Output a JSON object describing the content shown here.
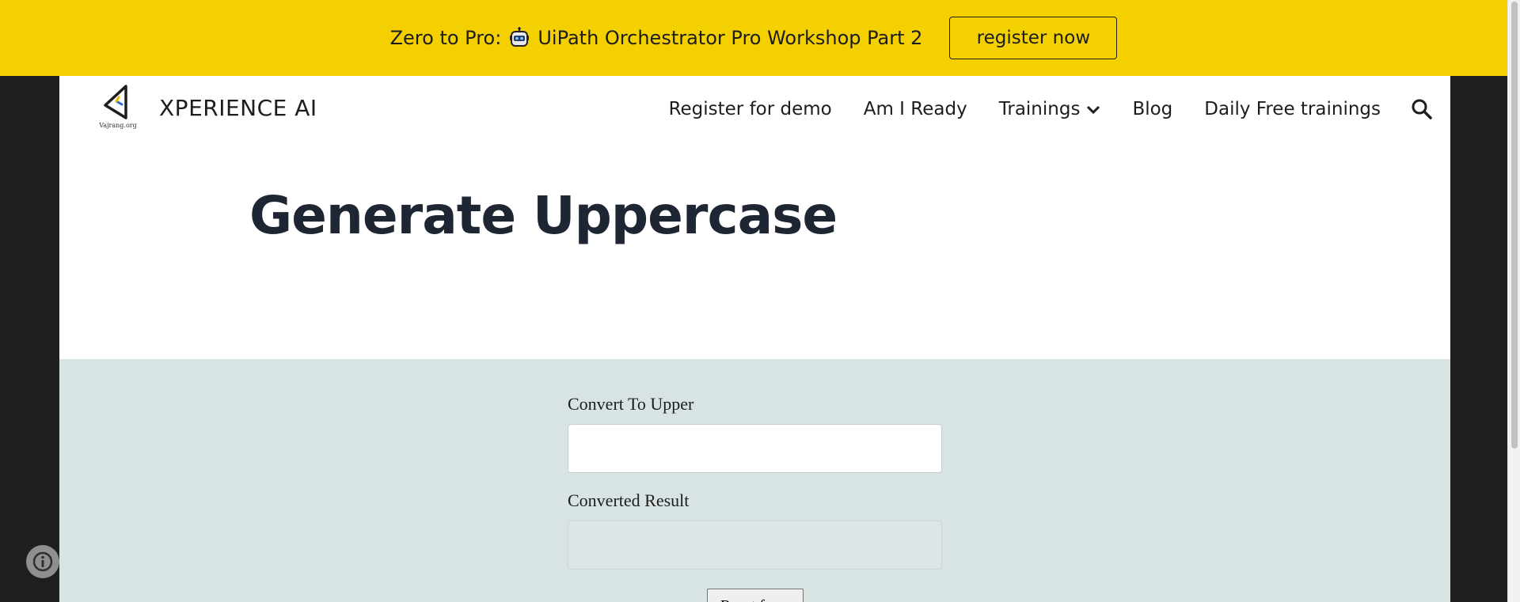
{
  "announcement": {
    "prefix": "Zero to Pro:",
    "title": "UiPath Orchestrator Pro Workshop Part 2",
    "register_label": "register now",
    "background_color": "#f4d000"
  },
  "header": {
    "logo_caption": "Vajrang.org",
    "site_title": "XPERIENCE AI",
    "nav": [
      {
        "label": "Register for demo"
      },
      {
        "label": "Am I Ready"
      },
      {
        "label": "Trainings",
        "icon": "chevron-down-icon"
      },
      {
        "label": "Blog"
      },
      {
        "label": "Daily Free trainings"
      }
    ],
    "search_icon": "search-icon"
  },
  "main": {
    "page_title": "Generate Uppercase"
  },
  "form": {
    "input_label": "Convert To Upper",
    "input_value": "",
    "result_label": "Converted Result",
    "result_value": "",
    "reset_label": "Reset form",
    "section_color": "#d8e3e4"
  },
  "info_icon": "info-icon"
}
